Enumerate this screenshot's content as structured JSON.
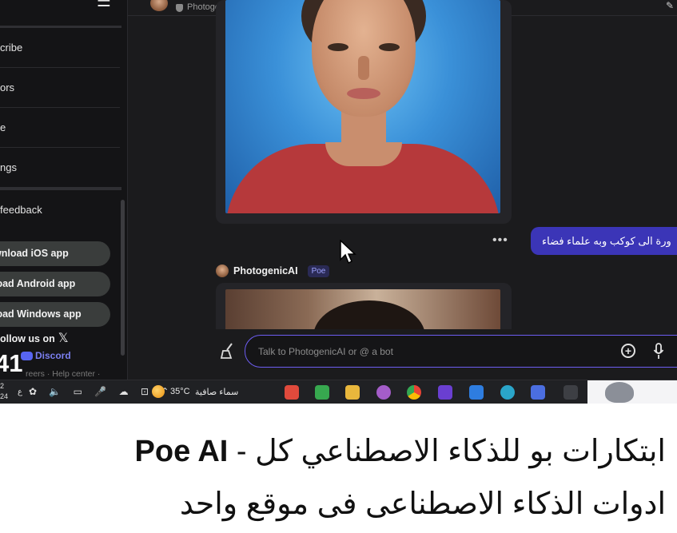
{
  "sidebar": {
    "items": [
      {
        "label": "cribe"
      },
      {
        "label": "ors"
      },
      {
        "label": "e"
      },
      {
        "label": "ngs"
      }
    ],
    "feedback_label": "feedback",
    "download_buttons": [
      {
        "label": "wnload iOS app"
      },
      {
        "label": "load Android app"
      },
      {
        "label": "load Windows app"
      }
    ],
    "follow_label": "ollow us on",
    "discord_label": "Discord",
    "footer_links": "reers · Help center ·",
    "overlay_timer": "41"
  },
  "header": {
    "bot_name": "PhotogenicAI"
  },
  "chat": {
    "user_message": "ورة الى كوكب وبه علماء فضاء",
    "bot_name": "PhotogenicAI",
    "bot_badge": "Poe",
    "more_icon": "•••"
  },
  "composer": {
    "placeholder": "Talk to PhotogenicAI or @ a bot"
  },
  "taskbar": {
    "date_line1": "2",
    "date_line2": "24",
    "language": "ع",
    "temperature": "35°C",
    "weather_text": "سماء صافية"
  },
  "caption": {
    "line1_brand": "Poe AI",
    "line1_rest": "ابتكارات بو للذكاء الاصطناعي كل -",
    "line2": "ادوات الذكاء الاصطناعى فى موقع واحد"
  },
  "colors": {
    "accent": "#6d5df2",
    "user_bubble": "#3b35b7",
    "background": "#1b1b1d"
  }
}
